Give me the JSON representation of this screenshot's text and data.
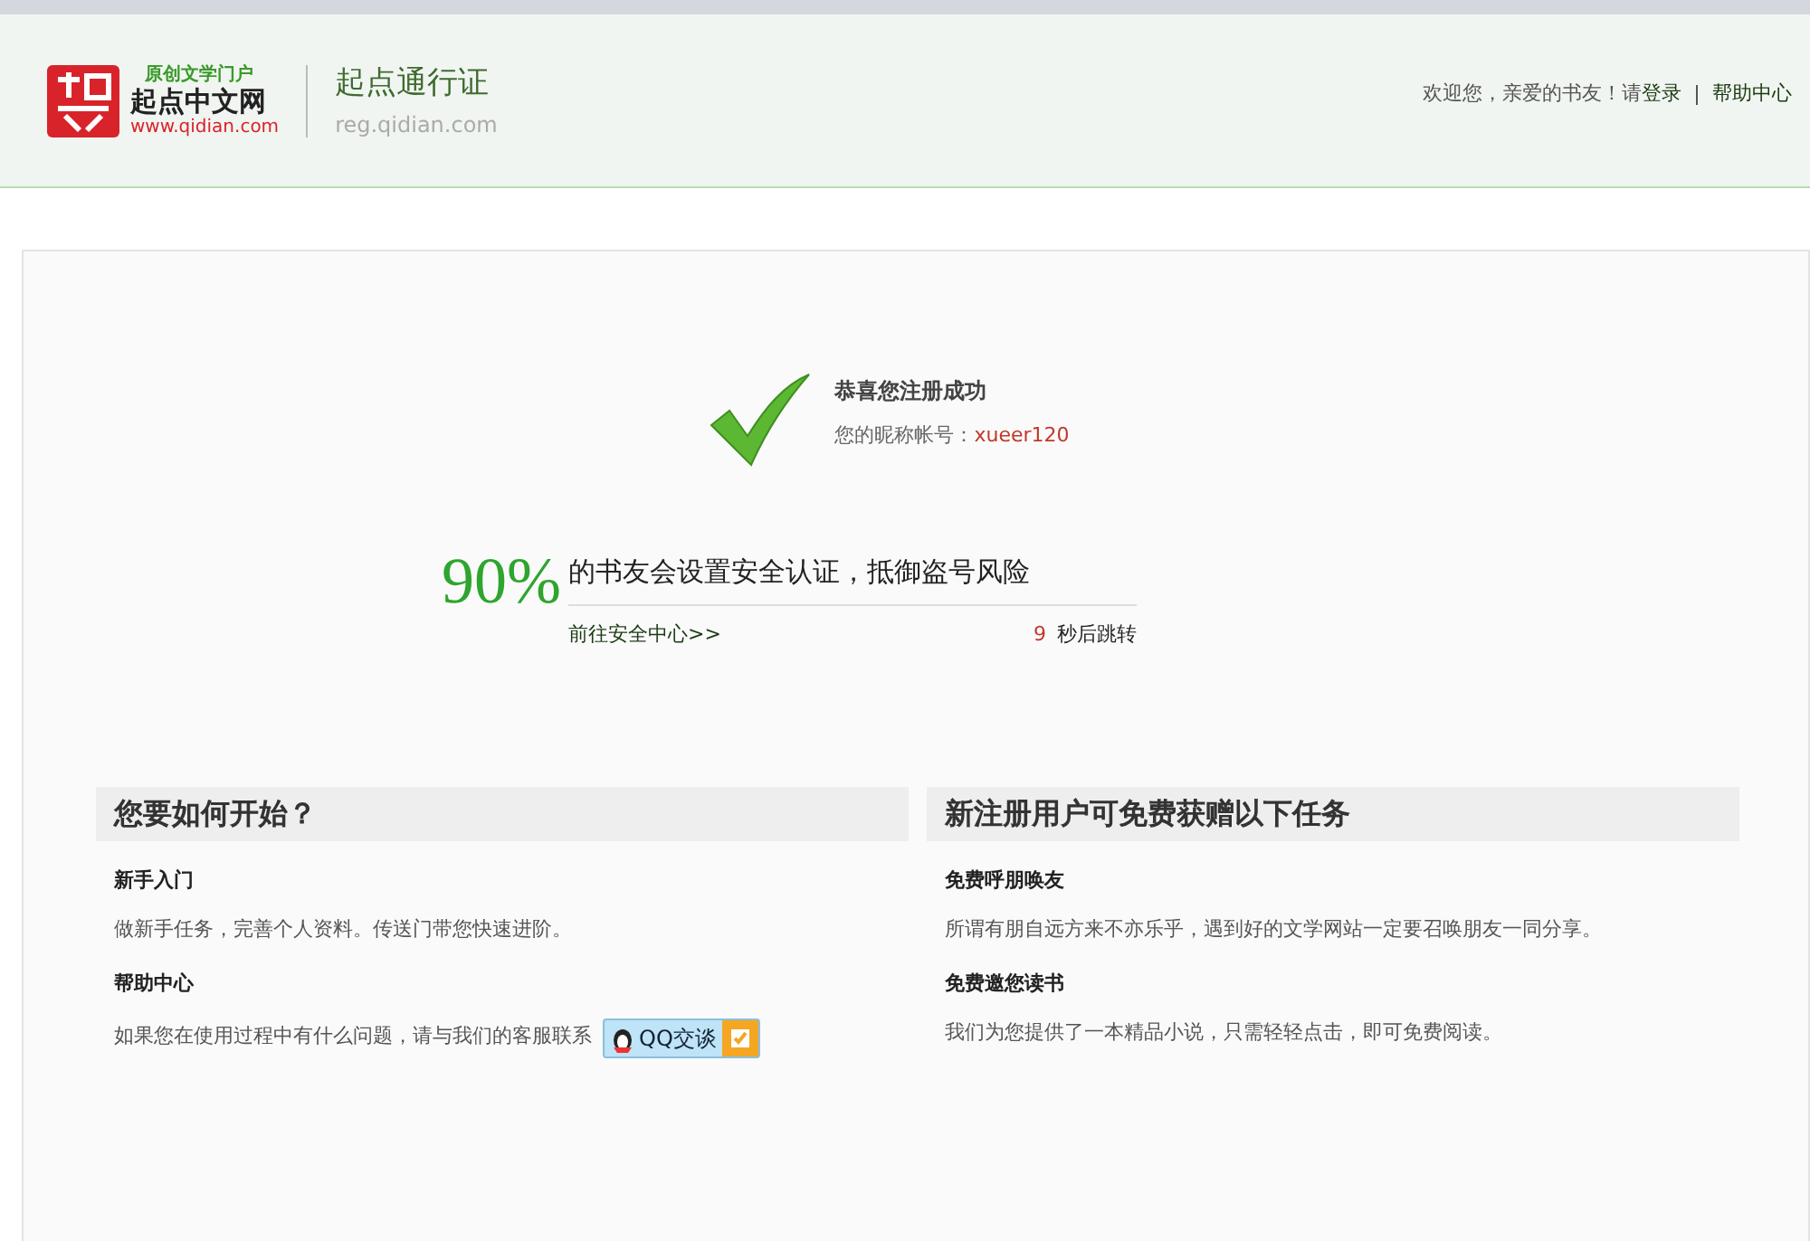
{
  "header": {
    "logo": {
      "tagline": "原创文学门户",
      "name": "起点中文网",
      "url": "www.qidian.com"
    },
    "site_title": "起点通行证",
    "site_url": "reg.qidian.com",
    "welcome": "欢迎您，亲爱的书友！请",
    "login": "登录",
    "help": "帮助中心"
  },
  "success": {
    "title": "恭喜您注册成功",
    "account_label": "您的昵称帐号：",
    "account": "xueer120"
  },
  "security": {
    "percent": "90%",
    "message": "的书友会设置安全认证，抵御盗号风险",
    "link": "前往安全中心>>",
    "countdown": "9",
    "countdown_label": "秒后跳转"
  },
  "panels": [
    {
      "title": "您要如何开始？",
      "items": [
        {
          "heading": "新手入门",
          "text": "做新手任务，完善个人资料。传送门带您快速进阶。"
        },
        {
          "heading": "帮助中心",
          "text": "如果您在使用过程中有什么问题，请与我们的客服联系",
          "button": "QQ交谈"
        }
      ]
    },
    {
      "title": "新注册用户可免费获赠以下任务",
      "items": [
        {
          "heading": "免费呼朋唤友",
          "text": "所谓有朋自远方来不亦乐乎，遇到好的文学网站一定要召唤朋友一同分享。"
        },
        {
          "heading": "免费邀您读书",
          "text": "我们为您提供了一本精品小说，只需轻轻点击，即可免费阅读。"
        }
      ]
    }
  ]
}
